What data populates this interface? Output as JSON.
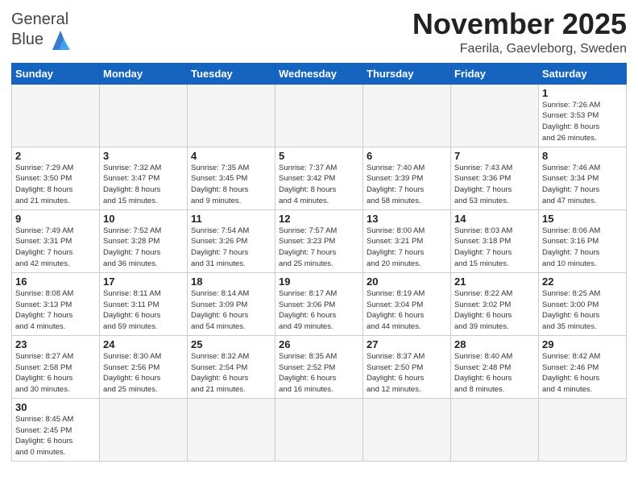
{
  "header": {
    "logo_general": "General",
    "logo_blue": "Blue",
    "month": "November 2025",
    "location": "Faerila, Gaevleborg, Sweden"
  },
  "weekdays": [
    "Sunday",
    "Monday",
    "Tuesday",
    "Wednesday",
    "Thursday",
    "Friday",
    "Saturday"
  ],
  "weeks": [
    [
      {
        "day": "",
        "info": ""
      },
      {
        "day": "",
        "info": ""
      },
      {
        "day": "",
        "info": ""
      },
      {
        "day": "",
        "info": ""
      },
      {
        "day": "",
        "info": ""
      },
      {
        "day": "",
        "info": ""
      },
      {
        "day": "1",
        "info": "Sunrise: 7:26 AM\nSunset: 3:53 PM\nDaylight: 8 hours\nand 26 minutes."
      }
    ],
    [
      {
        "day": "2",
        "info": "Sunrise: 7:29 AM\nSunset: 3:50 PM\nDaylight: 8 hours\nand 21 minutes."
      },
      {
        "day": "3",
        "info": "Sunrise: 7:32 AM\nSunset: 3:47 PM\nDaylight: 8 hours\nand 15 minutes."
      },
      {
        "day": "4",
        "info": "Sunrise: 7:35 AM\nSunset: 3:45 PM\nDaylight: 8 hours\nand 9 minutes."
      },
      {
        "day": "5",
        "info": "Sunrise: 7:37 AM\nSunset: 3:42 PM\nDaylight: 8 hours\nand 4 minutes."
      },
      {
        "day": "6",
        "info": "Sunrise: 7:40 AM\nSunset: 3:39 PM\nDaylight: 7 hours\nand 58 minutes."
      },
      {
        "day": "7",
        "info": "Sunrise: 7:43 AM\nSunset: 3:36 PM\nDaylight: 7 hours\nand 53 minutes."
      },
      {
        "day": "8",
        "info": "Sunrise: 7:46 AM\nSunset: 3:34 PM\nDaylight: 7 hours\nand 47 minutes."
      }
    ],
    [
      {
        "day": "9",
        "info": "Sunrise: 7:49 AM\nSunset: 3:31 PM\nDaylight: 7 hours\nand 42 minutes."
      },
      {
        "day": "10",
        "info": "Sunrise: 7:52 AM\nSunset: 3:28 PM\nDaylight: 7 hours\nand 36 minutes."
      },
      {
        "day": "11",
        "info": "Sunrise: 7:54 AM\nSunset: 3:26 PM\nDaylight: 7 hours\nand 31 minutes."
      },
      {
        "day": "12",
        "info": "Sunrise: 7:57 AM\nSunset: 3:23 PM\nDaylight: 7 hours\nand 25 minutes."
      },
      {
        "day": "13",
        "info": "Sunrise: 8:00 AM\nSunset: 3:21 PM\nDaylight: 7 hours\nand 20 minutes."
      },
      {
        "day": "14",
        "info": "Sunrise: 8:03 AM\nSunset: 3:18 PM\nDaylight: 7 hours\nand 15 minutes."
      },
      {
        "day": "15",
        "info": "Sunrise: 8:06 AM\nSunset: 3:16 PM\nDaylight: 7 hours\nand 10 minutes."
      }
    ],
    [
      {
        "day": "16",
        "info": "Sunrise: 8:08 AM\nSunset: 3:13 PM\nDaylight: 7 hours\nand 4 minutes."
      },
      {
        "day": "17",
        "info": "Sunrise: 8:11 AM\nSunset: 3:11 PM\nDaylight: 6 hours\nand 59 minutes."
      },
      {
        "day": "18",
        "info": "Sunrise: 8:14 AM\nSunset: 3:09 PM\nDaylight: 6 hours\nand 54 minutes."
      },
      {
        "day": "19",
        "info": "Sunrise: 8:17 AM\nSunset: 3:06 PM\nDaylight: 6 hours\nand 49 minutes."
      },
      {
        "day": "20",
        "info": "Sunrise: 8:19 AM\nSunset: 3:04 PM\nDaylight: 6 hours\nand 44 minutes."
      },
      {
        "day": "21",
        "info": "Sunrise: 8:22 AM\nSunset: 3:02 PM\nDaylight: 6 hours\nand 39 minutes."
      },
      {
        "day": "22",
        "info": "Sunrise: 8:25 AM\nSunset: 3:00 PM\nDaylight: 6 hours\nand 35 minutes."
      }
    ],
    [
      {
        "day": "23",
        "info": "Sunrise: 8:27 AM\nSunset: 2:58 PM\nDaylight: 6 hours\nand 30 minutes."
      },
      {
        "day": "24",
        "info": "Sunrise: 8:30 AM\nSunset: 2:56 PM\nDaylight: 6 hours\nand 25 minutes."
      },
      {
        "day": "25",
        "info": "Sunrise: 8:32 AM\nSunset: 2:54 PM\nDaylight: 6 hours\nand 21 minutes."
      },
      {
        "day": "26",
        "info": "Sunrise: 8:35 AM\nSunset: 2:52 PM\nDaylight: 6 hours\nand 16 minutes."
      },
      {
        "day": "27",
        "info": "Sunrise: 8:37 AM\nSunset: 2:50 PM\nDaylight: 6 hours\nand 12 minutes."
      },
      {
        "day": "28",
        "info": "Sunrise: 8:40 AM\nSunset: 2:48 PM\nDaylight: 6 hours\nand 8 minutes."
      },
      {
        "day": "29",
        "info": "Sunrise: 8:42 AM\nSunset: 2:46 PM\nDaylight: 6 hours\nand 4 minutes."
      }
    ],
    [
      {
        "day": "30",
        "info": "Sunrise: 8:45 AM\nSunset: 2:45 PM\nDaylight: 6 hours\nand 0 minutes."
      },
      {
        "day": "",
        "info": ""
      },
      {
        "day": "",
        "info": ""
      },
      {
        "day": "",
        "info": ""
      },
      {
        "day": "",
        "info": ""
      },
      {
        "day": "",
        "info": ""
      },
      {
        "day": "",
        "info": ""
      }
    ]
  ]
}
